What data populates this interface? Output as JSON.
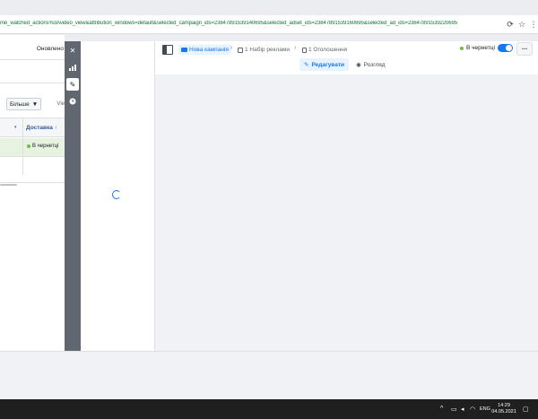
{
  "browser": {
    "url": "me_watched_actions%3Avideo_view&attribution_windows=default&selected_campaign_ids=23847891539140695&selected_adset_ids=23847891539160695&selected_ad_ids=23847891539220695"
  },
  "left_table": {
    "updated_label": "Оновлено",
    "more_button": "Більше",
    "view_label": "Vie",
    "column_title": "Доставка ↑",
    "row_status": "В чернетці"
  },
  "editor": {
    "breadcrumbs": [
      {
        "label": "Нова кампанія"
      },
      {
        "label": "1 Набір реклами"
      },
      {
        "label": "1 Оголошення"
      }
    ],
    "status": "В чернетці",
    "more_label": "···",
    "edit_label": "Редагувати",
    "preview_label": "Розгляд"
  },
  "taskbar": {
    "lang": "ENG",
    "time": "14:29",
    "date": "04.05.2021"
  },
  "colors": {
    "accent": "#1877f2",
    "url_green": "#137333",
    "draft_dot": "#6cbe45",
    "toolbar_dark": "#606770"
  }
}
